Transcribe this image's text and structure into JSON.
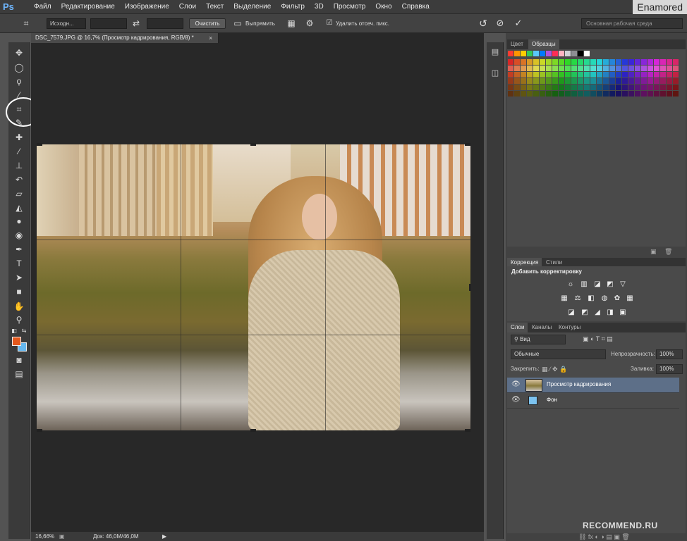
{
  "app": {
    "logo": "Ps",
    "watermark_top": "Enamored",
    "watermark_bottom": "RECOMMEND.RU"
  },
  "menu": {
    "items": [
      "Файл",
      "Редактирование",
      "Изображение",
      "Слои",
      "Текст",
      "Выделение",
      "Фильтр",
      "3D",
      "Просмотр",
      "Окно",
      "Справка"
    ]
  },
  "options": {
    "ratio_value": "Исходн...",
    "clear_label": "Очистить",
    "straighten_label": "Выпрямить",
    "delete_cropped_label": "Удалить отсеч. пикс.",
    "workspace_value": "Основная рабочая среда"
  },
  "document": {
    "tab_title": "DSC_7579.JPG @ 16,7% (Просмотр кадрирования, RGB/8) *",
    "close_glyph": "×"
  },
  "status": {
    "zoom": "16,66%",
    "doc_info": "Док: 46,0M/46,0M"
  },
  "colors": {
    "foreground": "#e3581d",
    "background": "#66b7ee",
    "selected_layer": "#5d6f88"
  },
  "panels": {
    "swatches_tabs": [
      "Цвет",
      "Образцы"
    ],
    "correction_tabs": [
      "Коррекция",
      "Стили"
    ],
    "correction_title": "Добавить корректировку",
    "layers_tabs": [
      "Слои",
      "Каналы",
      "Контуры"
    ],
    "layer_filter": "Вид",
    "blend_mode": "Обычные",
    "opacity_label": "Непрозрачность:",
    "opacity_value": "100%",
    "lock_label": "Закрепить:",
    "fill_label": "Заливка:",
    "fill_value": "100%",
    "layers": [
      {
        "name": "Просмотр кадрирования",
        "selected": true
      },
      {
        "name": "Фон",
        "selected": false
      }
    ]
  },
  "tool_icons": [
    "move-icon",
    "marquee-icon",
    "lasso-icon",
    "quick-select-icon",
    "crop-icon",
    "eyedropper-icon",
    "healing-brush-icon",
    "brush-icon",
    "clone-stamp-icon",
    "history-brush-icon",
    "eraser-icon",
    "paint-bucket-icon",
    "blur-icon",
    "dodge-icon",
    "pen-icon",
    "type-icon",
    "path-select-icon",
    "rectangle-icon",
    "hand-icon",
    "zoom-icon"
  ]
}
